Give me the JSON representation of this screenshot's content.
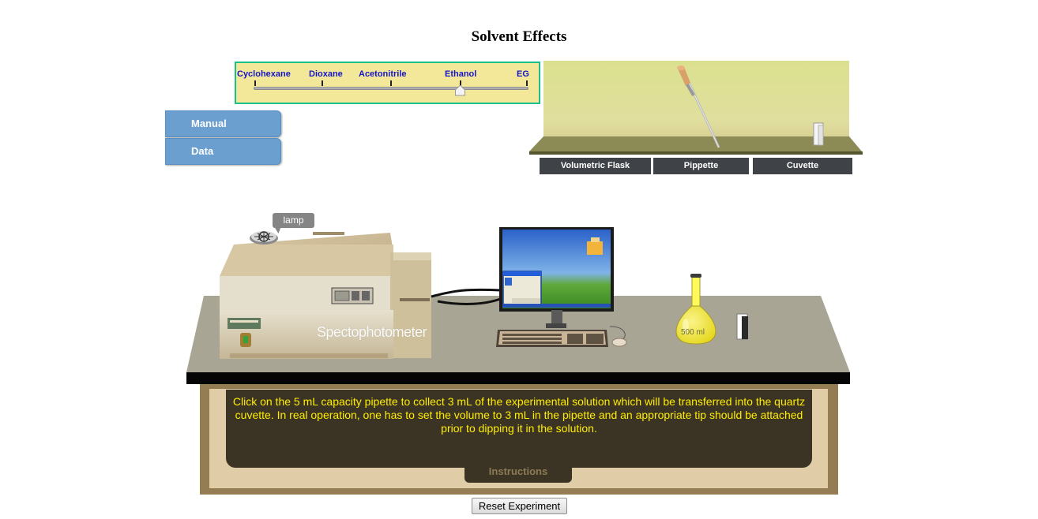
{
  "page": {
    "title": "Solvent Effects"
  },
  "solvent_selector": {
    "options": [
      "Cyclohexane",
      "Dioxane",
      "Acetonitrile",
      "Ethanol",
      "EG"
    ],
    "selected": "Ethanol"
  },
  "side_tabs": [
    {
      "label": "Manual"
    },
    {
      "label": "Data"
    }
  ],
  "equipment": [
    {
      "label": "Volumetric Flask"
    },
    {
      "label": "Pippette"
    },
    {
      "label": "Cuvette"
    }
  ],
  "bench": {
    "spectrophotometer_label": "Spectophotometer",
    "lamp_label": "lamp",
    "flask_label": "500  ml"
  },
  "instructions": {
    "text": "Click on the 5 mL capacity pipette to collect 3 mL of the experimental solution which will be transferred into the quartz cuvette. In real operation, one has to set the volume to 3 mL in the  pipette and an appropriate tip should be attached prior to dipping it in the solution.",
    "tab_label": "Instructions"
  },
  "reset_button": {
    "label": "Reset Experiment"
  },
  "colors": {
    "slider_border": "#19c08a",
    "slider_bg": "#f3e89a",
    "tab_blue": "#6a9fd0",
    "instruction_text": "#ffee00",
    "instruction_bg": "#3b3324",
    "solvent_label": "#1515c8"
  }
}
